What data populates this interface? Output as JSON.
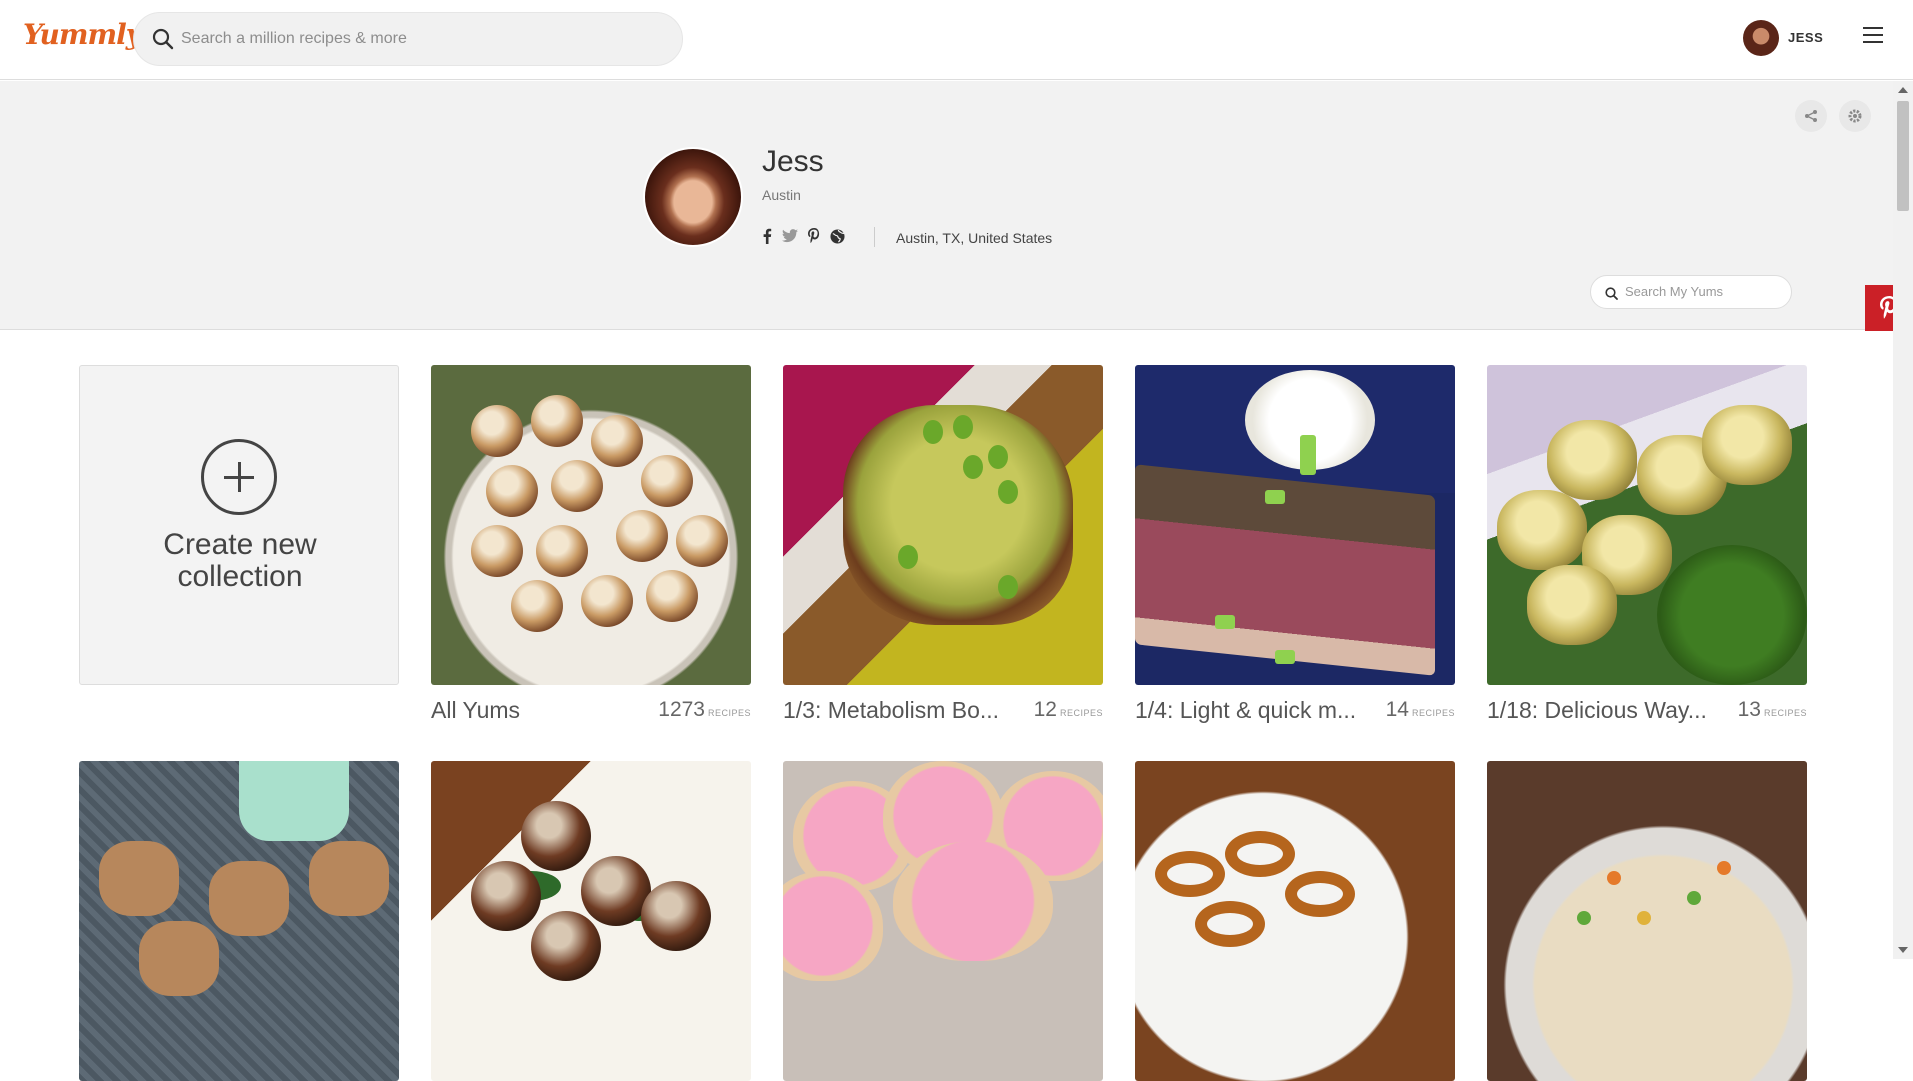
{
  "header": {
    "logo_text": "Yummly",
    "search_placeholder": "Search a million recipes & more",
    "user_name": "JESS"
  },
  "profile": {
    "name": "Jess",
    "city": "Austin",
    "location": "Austin, TX, United States",
    "social_icons": [
      "facebook-icon",
      "twitter-icon",
      "pinterest-icon",
      "globe-icon"
    ],
    "search_placeholder": "Search My Yums"
  },
  "create_card": {
    "label_line1": "Create new",
    "label_line2": "collection"
  },
  "collections": [
    {
      "title": "All Yums",
      "count": "1273",
      "count_label": "RECIPES"
    },
    {
      "title": "1/3: Metabolism Bo...",
      "count": "12",
      "count_label": "RECIPES"
    },
    {
      "title": "1/4: Light & quick m...",
      "count": "14",
      "count_label": "RECIPES"
    },
    {
      "title": "1/18: Delicious Way...",
      "count": "13",
      "count_label": "RECIPES"
    }
  ],
  "colors": {
    "brand": "#e16120",
    "pinterest": "#cb2027"
  }
}
